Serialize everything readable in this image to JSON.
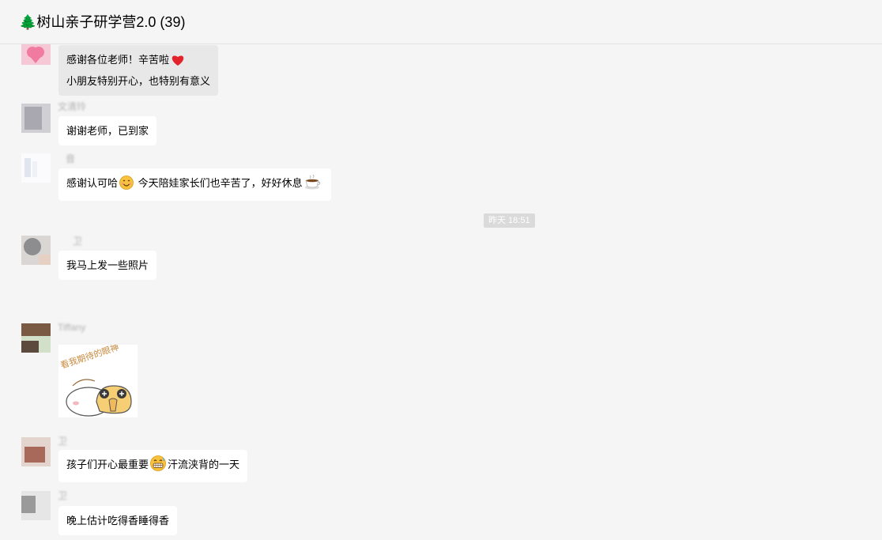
{
  "window": {
    "title": "🌲树山亲子研学营2.0 (39)"
  },
  "chat": {
    "time_divider": "昨天 18:51",
    "messages": [
      {
        "sender": "",
        "lines": [
          "感谢各位老师！辛苦啦",
          "小朋友特别开心，也特别有意义"
        ],
        "emoji": "heart-icon"
      },
      {
        "sender": "文清玲",
        "text": "谢谢老师，已到家"
      },
      {
        "sender": "音",
        "text_before": "感谢认可哈",
        "text_after": " 今天陪娃家长们也辛苦了，好好休息",
        "emoji1": "smile-icon",
        "emoji2": "coffee-icon"
      },
      {
        "sender": "卫",
        "text": "我马上发一些照片"
      },
      {
        "sender": "Tiffany",
        "sticker_caption": "看我期待的眼神"
      },
      {
        "sender": "卫",
        "text_before": "孩子们开心最重要",
        "text_after": "汗流浃背的一天",
        "emoji": "grin-icon"
      },
      {
        "sender": "卫",
        "text": "晚上估计吃得香睡得香"
      }
    ]
  }
}
